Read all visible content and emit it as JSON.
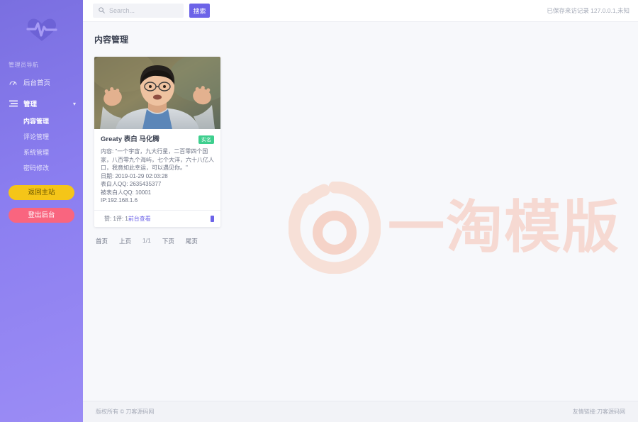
{
  "sidebar": {
    "logo_icon": "heartbeat-logo-icon",
    "nav_title": "管理员导航",
    "items": [
      {
        "label": "后台首页",
        "icon": "dashboard-icon"
      },
      {
        "label": "管理",
        "icon": "list-menu-icon",
        "chevron": "chevron-down-icon"
      }
    ],
    "sub_items": [
      {
        "label": "内容管理"
      },
      {
        "label": "评论管理"
      },
      {
        "label": "系统管理"
      },
      {
        "label": "密码修改"
      }
    ],
    "buttons": {
      "home": "返回主站",
      "logout": "登出后台"
    },
    "colors": {
      "bg_top": "#7a6fe0",
      "bg_bottom": "#9b8cf5",
      "btn_home": "#f5c518",
      "btn_logout": "#f9657f"
    }
  },
  "topbar": {
    "search_placeholder": "Search...",
    "search_value": "",
    "search_icon": "search-icon",
    "search_button": "搜索",
    "visit_record": "已保存来访记录 127.0.0.1,未知"
  },
  "main": {
    "page_title": "内容管理",
    "watermark_text": "一淘模版",
    "card": {
      "image_alt": "portrait-photo",
      "title": "Greaty 表白 马化腾",
      "badge": "实名",
      "content": "内容: \"一个宇宙，九大行星，二百零四个国家，八百零九个海屿，七个大洋，六十八亿人口，我竟如此幸运，可以遇见你。\"",
      "date": "日期: 2019-01-29 02:03:28",
      "sender_qq": "表白人QQ: 2635435377",
      "receiver_qq": "被表白人QQ: 10001",
      "ip": "IP:192.168.1.6",
      "stats_likes": "赞: 1",
      "stats_comments": "评: 1",
      "view_link": "前台查看",
      "delete_icon": "delete-icon"
    },
    "pagination": {
      "first": "首页",
      "prev": "上页",
      "current": "1/1",
      "next": "下页",
      "last": "尾页"
    }
  },
  "footer": {
    "copyright": "版权所有 © 刀客源码网",
    "friend_link": "友情链接:刀客源码网"
  }
}
